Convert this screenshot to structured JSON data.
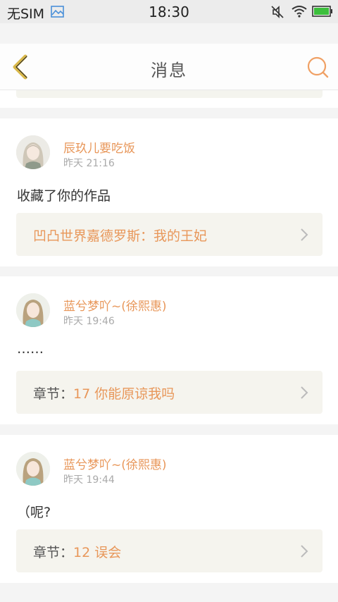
{
  "status_bar": {
    "carrier": "无SIM",
    "time": "18:30"
  },
  "header": {
    "title": "消息"
  },
  "messages": [
    {
      "username": "辰玖儿要吃饭",
      "time": "昨天 21:16",
      "text": "收藏了你的作品",
      "ref_prefix": "",
      "ref_title": "凹凸世界嘉德罗斯：我的王妃"
    },
    {
      "username": "蓝兮梦吖~(徐熙惠)",
      "time": "昨天 19:46",
      "text": "……",
      "ref_prefix": "章节：",
      "ref_title": "17 你能原谅我吗"
    },
    {
      "username": "蓝兮梦吖~(徐熙惠)",
      "time": "昨天 19:44",
      "text": "（呢?",
      "ref_prefix": "章节：",
      "ref_title": "12 误会"
    }
  ],
  "colors": {
    "accent": "#e8975a",
    "back_icon": "#d9b84a"
  }
}
